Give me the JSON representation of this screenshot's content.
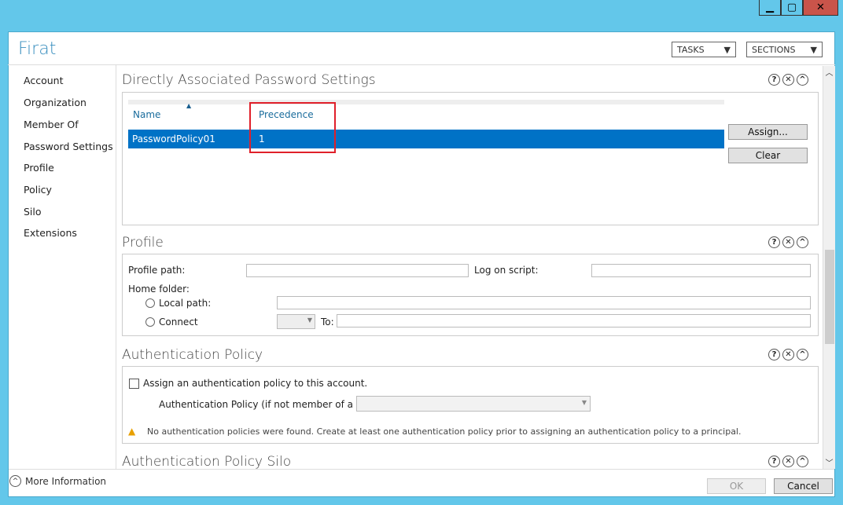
{
  "window": {
    "title": "Firat",
    "minimize_icon": "minimize-icon",
    "maximize_icon": "maximize-icon",
    "close_icon": "close-icon",
    "close_color": "#c9544a"
  },
  "header": {
    "tasks": "TASKS",
    "sections": "SECTIONS"
  },
  "nav": [
    "Account",
    "Organization",
    "Member Of",
    "Password Settings",
    "Profile",
    "Policy",
    "Silo",
    "Extensions"
  ],
  "password_settings": {
    "title": "Directly Associated Password Settings",
    "columns": [
      "Name",
      "Precedence"
    ],
    "rows": [
      {
        "name": "PasswordPolicy01",
        "precedence": "1"
      }
    ],
    "assign": "Assign...",
    "clear": "Clear",
    "selected_color": "#0072c6"
  },
  "profile": {
    "title": "Profile",
    "profile_path": "Profile path:",
    "logon_script": "Log on script:",
    "home_folder": "Home folder:",
    "local_path": "Local path:",
    "connect": "Connect",
    "to": "To:"
  },
  "auth_policy": {
    "title": "Authentication Policy",
    "checkbox": "Assign an authentication policy to this account.",
    "policy_label": "Authentication Policy (if not member of a Silo):",
    "warning": "No authentication policies were found. Create at least one authentication policy prior to assigning an authentication policy to a principal."
  },
  "silo": {
    "title": "Authentication Policy Silo"
  },
  "footer": {
    "more_info": "More Information",
    "ok": "OK",
    "cancel": "Cancel"
  },
  "section_controls": {
    "help": "?",
    "close": "✕",
    "collapse": "^"
  }
}
